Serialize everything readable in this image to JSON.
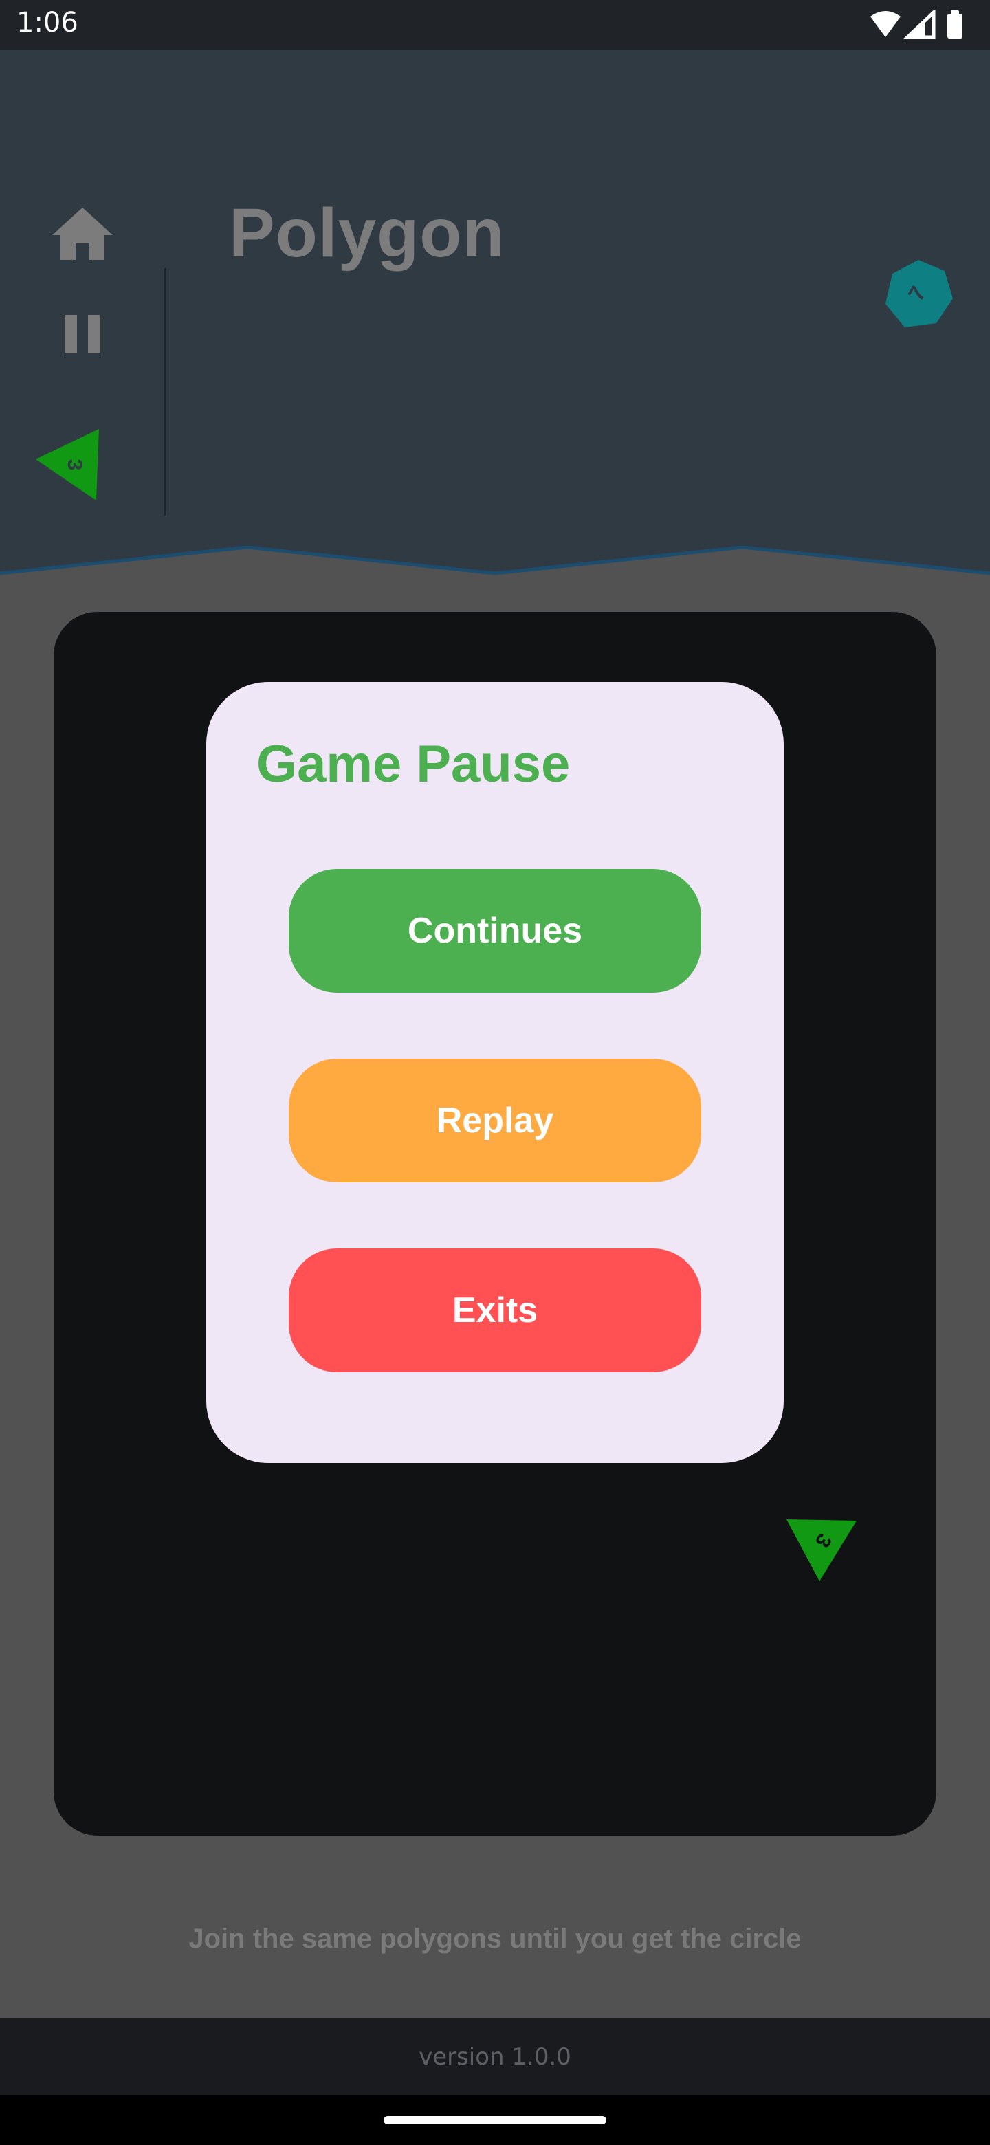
{
  "status_bar": {
    "time": "1:06",
    "icons": [
      "wifi-icon",
      "signal-icon",
      "battery-icon"
    ]
  },
  "header": {
    "title": "Polygon",
    "icons": [
      "home-icon",
      "pause-icon"
    ],
    "pieces": [
      {
        "shape": "triangle",
        "label": "3",
        "color": "#119914"
      },
      {
        "shape": "heptagon",
        "label": "7",
        "color": "#0e7f82"
      }
    ]
  },
  "board": {
    "pieces": [
      {
        "shape": "triangle",
        "label": "3",
        "color": "#119914"
      }
    ]
  },
  "pause_dialog": {
    "title": "Game Pause",
    "continue_label": "Continues",
    "replay_label": "Replay",
    "exit_label": "Exits",
    "colors": {
      "continue": "#4caf50",
      "replay": "#ffaa40",
      "exit": "#ff5153",
      "card": "#efe6f6"
    }
  },
  "hint": "Join the same polygons until you get the circle",
  "footer": {
    "version": "version 1.0.0"
  }
}
